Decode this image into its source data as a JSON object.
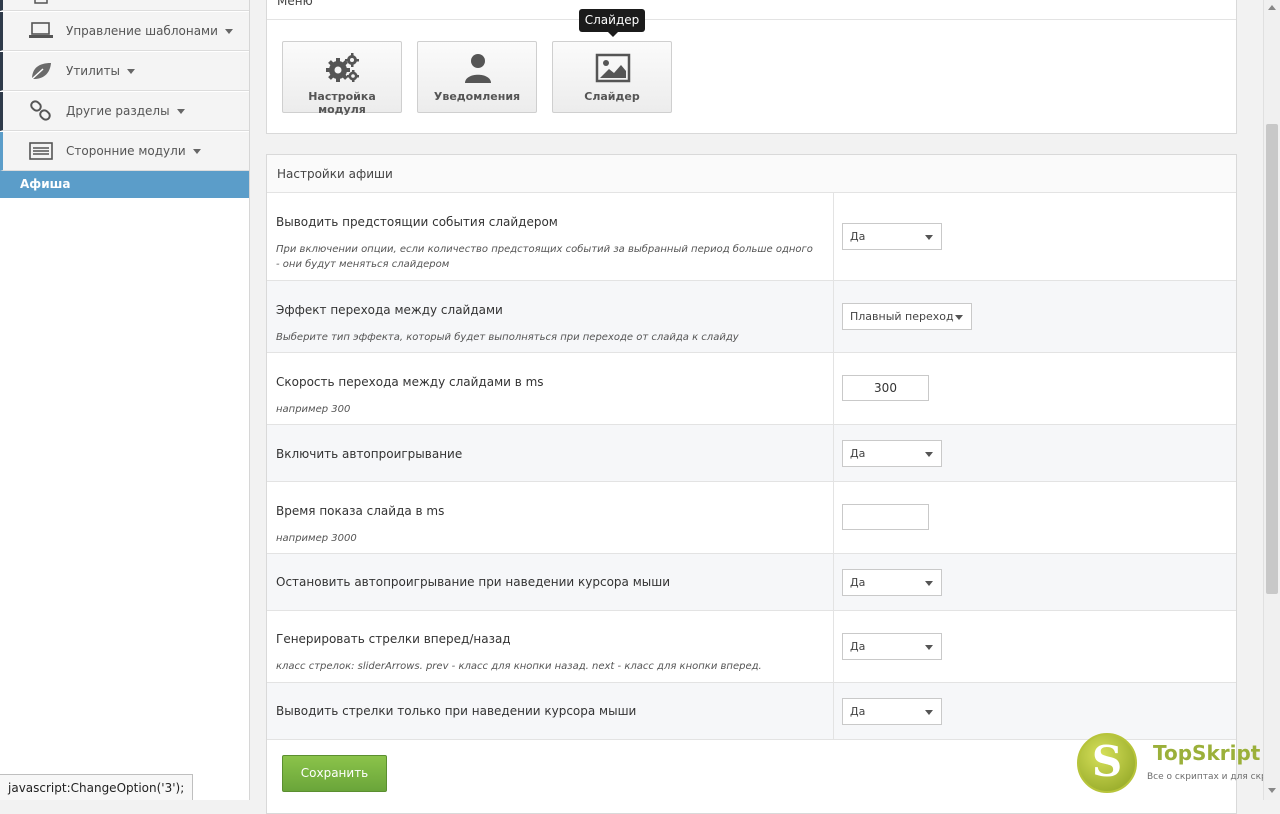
{
  "sidebar": {
    "items": [
      {
        "label": "Управление шаблонами",
        "icon": "laptop-icon"
      },
      {
        "label": "Утилиты",
        "icon": "leaf-icon"
      },
      {
        "label": "Другие разделы",
        "icon": "link-icon"
      },
      {
        "label": "Сторонние модули",
        "icon": "list-icon"
      }
    ],
    "active_item": "Афиша"
  },
  "menu_panel": {
    "title": "Меню",
    "buttons": [
      {
        "label": "Настройка модуля",
        "icon": "gears-icon"
      },
      {
        "label": "Уведомления",
        "icon": "user-icon"
      },
      {
        "label": "Слайдер",
        "icon": "image-icon"
      }
    ],
    "tooltip": "Слайдер"
  },
  "settings_panel": {
    "title": "Настройки афиши",
    "rows": [
      {
        "title": "Выводить предстоящии события слайдером",
        "desc": "При включении опции, если количество предстоящих событий за выбранный период больше одного - они будут меняться слайдером",
        "value": "Да"
      },
      {
        "title": "Эффект перехода между слайдами",
        "desc": "Выберите тип эффекта, который будет выполняться при переходе от слайда к слайду",
        "value": "Плавный переход"
      },
      {
        "title": "Скорость перехода между слайдами в ms",
        "desc": "например 300",
        "value": "300"
      },
      {
        "title": "Включить автопроигрывание",
        "desc": "",
        "value": "Да"
      },
      {
        "title": "Время показа слайда в ms",
        "desc": "например 3000",
        "value": ""
      },
      {
        "title": "Остановить автопроигрывание при наведении курсора мыши",
        "desc": "",
        "value": "Да"
      },
      {
        "title": "Генерировать стрелки вперед/назад",
        "desc": "класс стрелок: sliderArrows. prev - класс для кнопки назад. next - класс для кнопки вперед.",
        "value": "Да"
      },
      {
        "title": "Выводить стрелки только при наведении курсора мыши",
        "desc": "",
        "value": "Да"
      }
    ],
    "save_label": "Сохранить"
  },
  "statusbar": {
    "text": "javascript:ChangeOption('3');"
  },
  "watermark": {
    "title": "TopSkript",
    "tagline": "Все о скриптах и для скриптов..."
  },
  "colors": {
    "accent": "#5b9dc9",
    "save": "#7cb342",
    "tooltip": "#1b1b1b"
  }
}
